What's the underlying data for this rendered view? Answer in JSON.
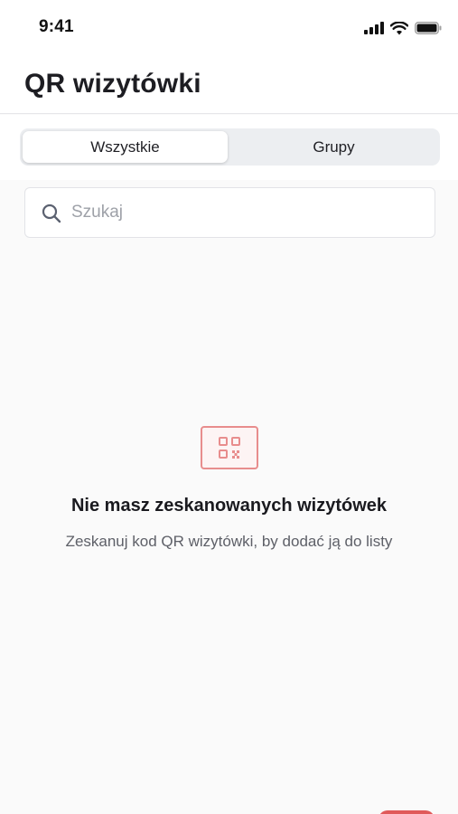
{
  "status_bar": {
    "time": "9:41",
    "icons": [
      "cellular-signal-icon",
      "wifi-icon",
      "battery-icon"
    ]
  },
  "header": {
    "title": "QR wizytówki"
  },
  "tabs": [
    {
      "label": "Wszystkie",
      "selected": true
    },
    {
      "label": "Grupy",
      "selected": false
    }
  ],
  "search": {
    "placeholder": "Szukaj",
    "value": "",
    "icon": "search-icon"
  },
  "empty_state": {
    "icon": "qr-code-icon",
    "title": "Nie masz zeskanowanych wizytówek",
    "description": "Zeskanuj kod QR wizytówki, by dodać ją do listy"
  },
  "colors": {
    "accent": "#e05a5a",
    "icon_stroke": "#e88d8d",
    "segment_bg": "#eceef1",
    "background": "#fafafa"
  }
}
